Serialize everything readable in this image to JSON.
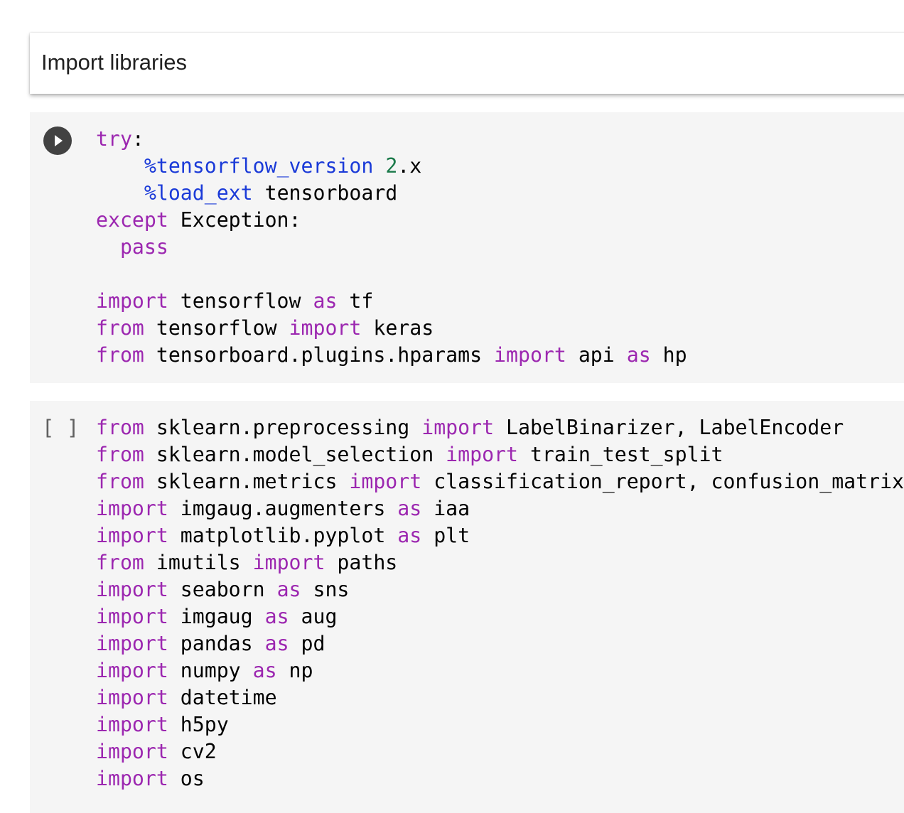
{
  "text_cell": {
    "title": "Import libraries"
  },
  "cells": [
    {
      "run_button": "play-icon",
      "lines": [
        [
          [
            "kw",
            "try"
          ],
          [
            "p",
            ":"
          ]
        ],
        [
          [
            "p",
            "    "
          ],
          [
            "mg",
            "%tensorflow_version"
          ],
          [
            "p",
            " "
          ],
          [
            "nm",
            "2"
          ],
          [
            "p",
            ".x"
          ]
        ],
        [
          [
            "p",
            "    "
          ],
          [
            "mg",
            "%load_ext"
          ],
          [
            "p",
            " tensorboard"
          ]
        ],
        [
          [
            "kw",
            "except"
          ],
          [
            "p",
            " Exception:"
          ]
        ],
        [
          [
            "p",
            "  "
          ],
          [
            "kw",
            "pass"
          ]
        ],
        [],
        [
          [
            "kw",
            "import"
          ],
          [
            "p",
            " tensorflow "
          ],
          [
            "kw",
            "as"
          ],
          [
            "p",
            " tf"
          ]
        ],
        [
          [
            "kw",
            "from"
          ],
          [
            "p",
            " tensorflow "
          ],
          [
            "kw",
            "import"
          ],
          [
            "p",
            " keras"
          ]
        ],
        [
          [
            "kw",
            "from"
          ],
          [
            "p",
            " tensorboard.plugins.hparams "
          ],
          [
            "kw",
            "import"
          ],
          [
            "p",
            " api "
          ],
          [
            "kw",
            "as"
          ],
          [
            "p",
            " hp"
          ]
        ]
      ]
    },
    {
      "exec_count": "[ ]",
      "lines": [
        [
          [
            "kw",
            "from"
          ],
          [
            "p",
            " sklearn.preprocessing "
          ],
          [
            "kw",
            "import"
          ],
          [
            "p",
            " LabelBinarizer, LabelEncoder"
          ]
        ],
        [
          [
            "kw",
            "from"
          ],
          [
            "p",
            " sklearn.model_selection "
          ],
          [
            "kw",
            "import"
          ],
          [
            "p",
            " train_test_split"
          ]
        ],
        [
          [
            "kw",
            "from"
          ],
          [
            "p",
            " sklearn.metrics "
          ],
          [
            "kw",
            "import"
          ],
          [
            "p",
            " classification_report, confusion_matrix"
          ]
        ],
        [
          [
            "kw",
            "import"
          ],
          [
            "p",
            " imgaug.augmenters "
          ],
          [
            "kw",
            "as"
          ],
          [
            "p",
            " iaa"
          ]
        ],
        [
          [
            "kw",
            "import"
          ],
          [
            "p",
            " matplotlib.pyplot "
          ],
          [
            "kw",
            "as"
          ],
          [
            "p",
            " plt"
          ]
        ],
        [
          [
            "kw",
            "from"
          ],
          [
            "p",
            " imutils "
          ],
          [
            "kw",
            "import"
          ],
          [
            "p",
            " paths"
          ]
        ],
        [
          [
            "kw",
            "import"
          ],
          [
            "p",
            " seaborn "
          ],
          [
            "kw",
            "as"
          ],
          [
            "p",
            " sns"
          ]
        ],
        [
          [
            "kw",
            "import"
          ],
          [
            "p",
            " imgaug "
          ],
          [
            "kw",
            "as"
          ],
          [
            "p",
            " aug"
          ]
        ],
        [
          [
            "kw",
            "import"
          ],
          [
            "p",
            " pandas "
          ],
          [
            "kw",
            "as"
          ],
          [
            "p",
            " pd"
          ]
        ],
        [
          [
            "kw",
            "import"
          ],
          [
            "p",
            " numpy "
          ],
          [
            "kw",
            "as"
          ],
          [
            "p",
            " np"
          ]
        ],
        [
          [
            "kw",
            "import"
          ],
          [
            "p",
            " datetime"
          ]
        ],
        [
          [
            "kw",
            "import"
          ],
          [
            "p",
            " h5py"
          ]
        ],
        [
          [
            "kw",
            "import"
          ],
          [
            "p",
            " cv2"
          ]
        ],
        [
          [
            "kw",
            "import"
          ],
          [
            "p",
            " os"
          ]
        ]
      ]
    }
  ],
  "colors": {
    "keyword": "#9c27b0",
    "magic": "#1a3ad8",
    "number": "#1b7a4a",
    "plain": "#000000",
    "cell_background": "#f5f5f5",
    "run_button": "#424242"
  }
}
